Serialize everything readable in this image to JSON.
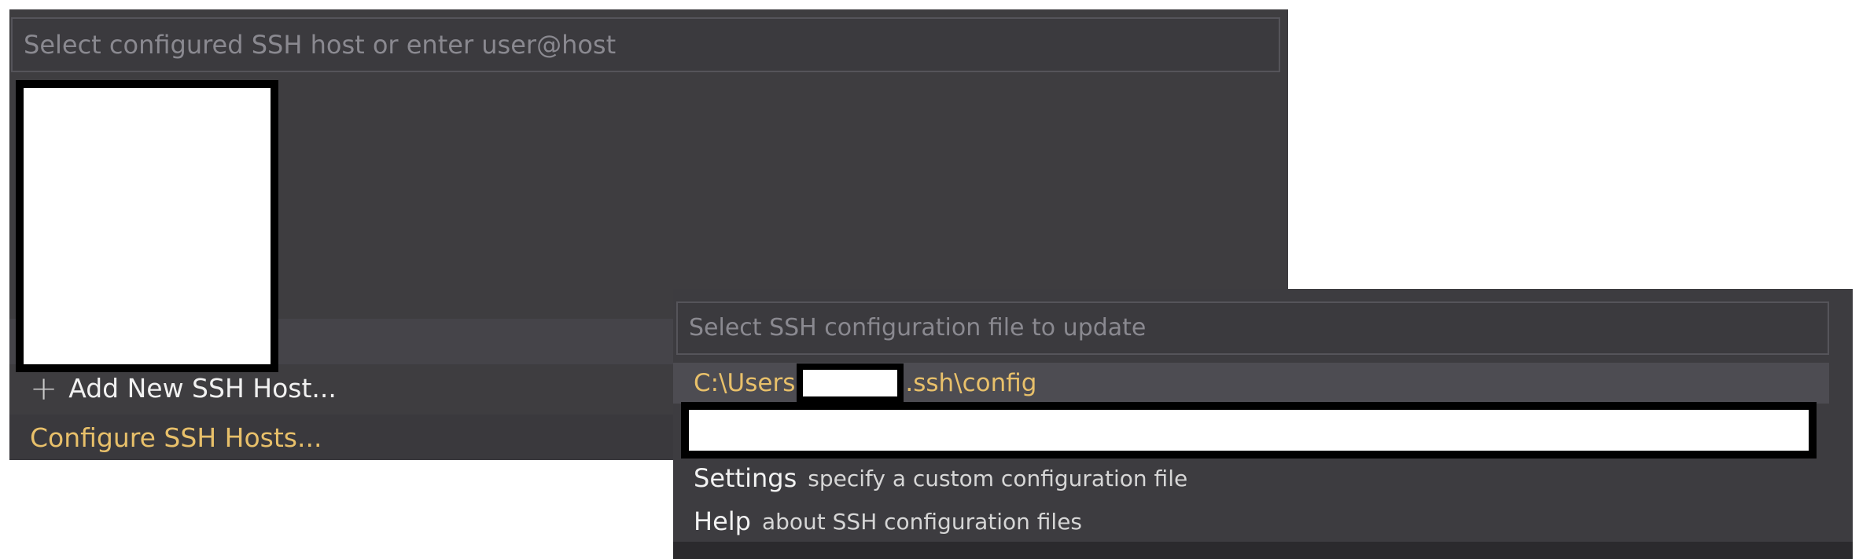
{
  "ssh_host_picker": {
    "placeholder": "Select configured SSH host or enter user@host",
    "add_host_label": "Add New SSH Host...",
    "configure_label": "Configure SSH Hosts...",
    "plus_icon": "plus-icon"
  },
  "ssh_config_picker": {
    "placeholder": "Select SSH configuration file to update",
    "config_path_prefix": "C:\\Users",
    "config_path_suffix": ".ssh\\config",
    "settings_keyword": "Settings",
    "settings_desc": "specify a custom configuration file",
    "help_keyword": "Help",
    "help_desc": "about SSH configuration files"
  },
  "colors": {
    "panel_bg": "#3e3d40",
    "accent_yellow": "#e8c06a",
    "text_light": "#f1f1f1"
  }
}
